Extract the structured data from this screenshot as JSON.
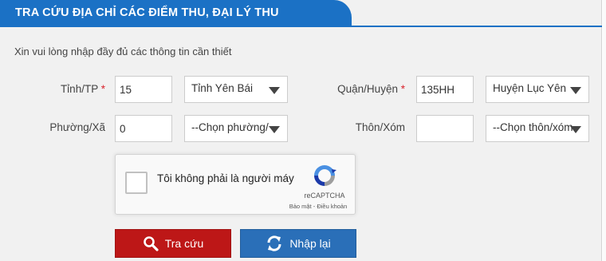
{
  "header": {
    "title": "TRA CỨU ĐỊA CHỈ CÁC ĐIỂM THU, ĐẠI LÝ THU"
  },
  "intro": "Xin vui lòng nhập đầy đủ các thông tin cần thiết",
  "form": {
    "province": {
      "label": "Tỉnh/TP",
      "required_mark": "*",
      "code": "15",
      "selected": "Tỉnh Yên Bái"
    },
    "district": {
      "label": "Quận/Huyện",
      "required_mark": "*",
      "code": "135HH",
      "selected": "Huyện Lục Yên"
    },
    "ward": {
      "label": "Phường/Xã",
      "code": "0",
      "selected": "--Chọn phường/"
    },
    "hamlet": {
      "label": "Thôn/Xóm",
      "code": "",
      "selected": "--Chọn thôn/xóm"
    }
  },
  "captcha": {
    "text": "Tôi không phải là người máy",
    "brand": "reCAPTCHA",
    "terms": "Bảo mật - Điều khoản"
  },
  "buttons": {
    "search": "Tra cứu",
    "reset": "Nhập lại"
  },
  "colors": {
    "header_blue": "#1b71c5",
    "search_red": "#bd1717",
    "reset_blue": "#2a6fb8",
    "required_red": "#d9232d"
  },
  "icons": {
    "search": "magnifier-icon",
    "reset": "refresh-icon",
    "dropdown": "caret-down-icon",
    "captcha": "recaptcha-logo-icon"
  }
}
